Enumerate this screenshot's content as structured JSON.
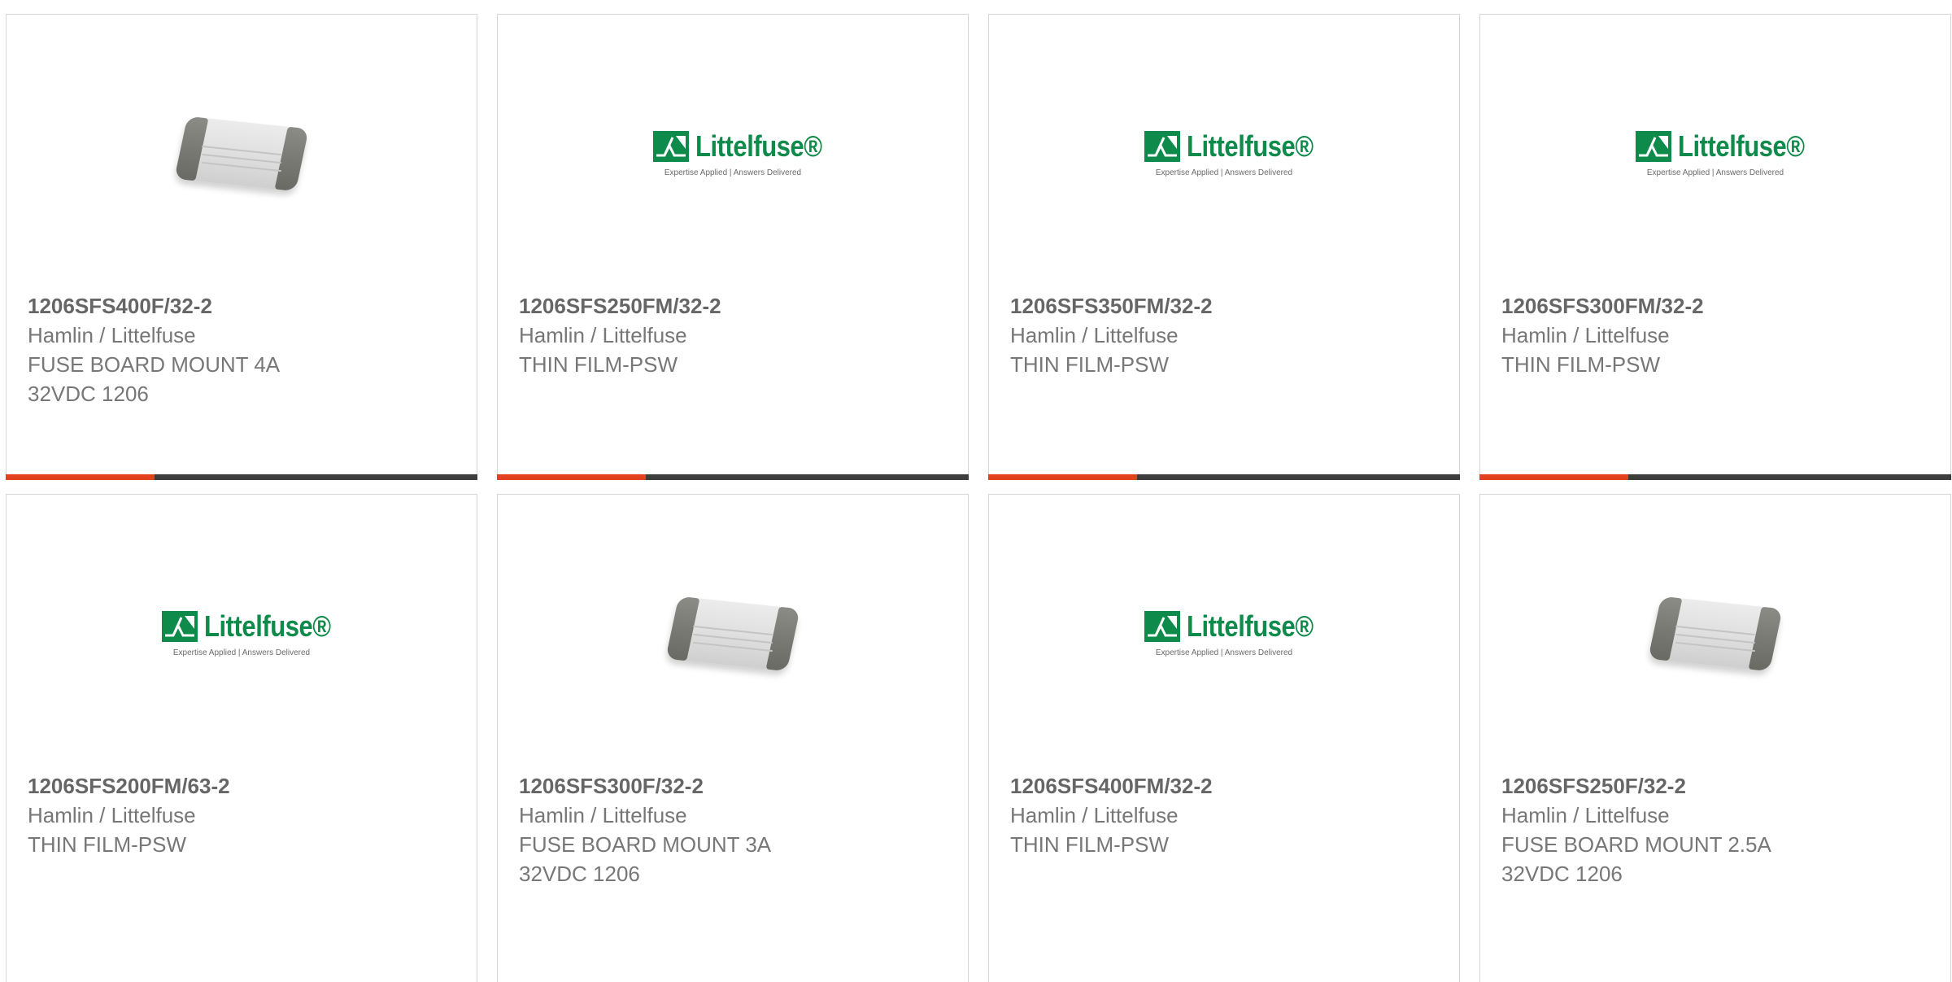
{
  "products": [
    {
      "part": "1206SFS400F/32-2",
      "maker": "Hamlin / Littelfuse",
      "desc1": "FUSE BOARD MOUNT 4A",
      "desc2": "32VDC 1206",
      "image": "fuse-chip"
    },
    {
      "part": "1206SFS250FM/32-2",
      "maker": "Hamlin / Littelfuse",
      "desc1": "THIN FILM-PSW",
      "desc2": "",
      "image": "littelfuse-logo"
    },
    {
      "part": "1206SFS350FM/32-2",
      "maker": "Hamlin / Littelfuse",
      "desc1": "THIN FILM-PSW",
      "desc2": "",
      "image": "littelfuse-logo"
    },
    {
      "part": "1206SFS300FM/32-2",
      "maker": "Hamlin / Littelfuse",
      "desc1": "THIN FILM-PSW",
      "desc2": "",
      "image": "littelfuse-logo"
    },
    {
      "part": "1206SFS200FM/63-2",
      "maker": "Hamlin / Littelfuse",
      "desc1": "THIN FILM-PSW",
      "desc2": "",
      "image": "littelfuse-logo"
    },
    {
      "part": "1206SFS300F/32-2",
      "maker": "Hamlin / Littelfuse",
      "desc1": "FUSE BOARD MOUNT 3A",
      "desc2": "32VDC 1206",
      "image": "fuse-chip"
    },
    {
      "part": "1206SFS400FM/32-2",
      "maker": "Hamlin / Littelfuse",
      "desc1": "THIN FILM-PSW",
      "desc2": "",
      "image": "littelfuse-logo"
    },
    {
      "part": "1206SFS250F/32-2",
      "maker": "Hamlin / Littelfuse",
      "desc1": "FUSE BOARD MOUNT 2.5A",
      "desc2": "32VDC 1206",
      "image": "fuse-chip"
    }
  ],
  "logo": {
    "word": "Littelfuse",
    "tagline": "Expertise Applied | Answers Delivered"
  },
  "colors": {
    "accent": "#e2431e",
    "bar": "#3d3d3d",
    "brand_green": "#0e8a4a",
    "text": "#777777"
  }
}
